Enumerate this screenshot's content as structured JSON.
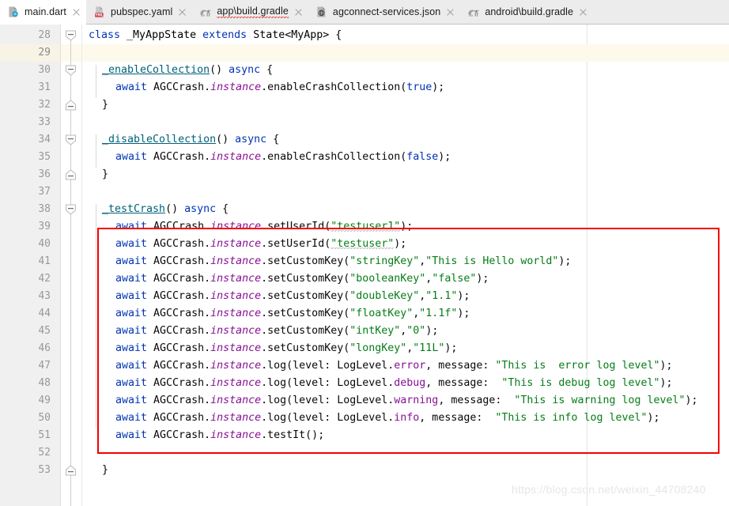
{
  "window": {
    "app": "IntelliJ IDEA / Android Studio editor",
    "background_color": "#ffffff",
    "accent_red": "#f50000"
  },
  "tabs": [
    {
      "label": "main.dart",
      "icon": "dart-file-icon",
      "active": true,
      "close": "×",
      "error": false
    },
    {
      "label": "pubspec.yaml",
      "icon": "yaml-file-icon",
      "active": false,
      "close": "×",
      "error": false
    },
    {
      "label": "app\\build.gradle",
      "icon": "gradle-file-icon",
      "active": false,
      "close": "×",
      "error": true
    },
    {
      "label": "agconnect-services.json",
      "icon": "json-file-icon",
      "active": false,
      "close": "×",
      "error": false
    },
    {
      "label": "android\\build.gradle",
      "icon": "gradle-file-icon",
      "active": false,
      "close": "×",
      "error": false
    }
  ],
  "editor": {
    "language": "Dart",
    "first_line": 28,
    "caret_line": 29,
    "line_height": 22,
    "lines": [
      {
        "number": 28,
        "indent": 0,
        "fold": "down",
        "tokens": [
          {
            "t": "class",
            "c": "k"
          },
          {
            "t": " ",
            "c": "pun"
          },
          {
            "t": "_MyAppState",
            "c": "cls"
          },
          {
            "t": " ",
            "c": "pun"
          },
          {
            "t": "extends",
            "c": "k"
          },
          {
            "t": " ",
            "c": "pun"
          },
          {
            "t": "State<MyApp> {",
            "c": "typ"
          }
        ]
      },
      {
        "number": 29,
        "indent": 0,
        "fold": "",
        "tokens": []
      },
      {
        "number": 30,
        "indent": 1,
        "fold": "down",
        "tokens": [
          {
            "t": "_enableCollection",
            "c": "mdecl"
          },
          {
            "t": "() ",
            "c": "pun"
          },
          {
            "t": "async",
            "c": "k"
          },
          {
            "t": " {",
            "c": "pun"
          }
        ]
      },
      {
        "number": 31,
        "indent": 2,
        "fold": "",
        "tokens": [
          {
            "t": "await",
            "c": "k"
          },
          {
            "t": " AGCCrash.",
            "c": "id"
          },
          {
            "t": "instance",
            "c": "fld"
          },
          {
            "t": ".enableCrashCollection(",
            "c": "id"
          },
          {
            "t": "true",
            "c": "k"
          },
          {
            "t": ");",
            "c": "pun"
          }
        ]
      },
      {
        "number": 32,
        "indent": 1,
        "fold": "up",
        "tokens": [
          {
            "t": "}",
            "c": "pun"
          }
        ]
      },
      {
        "number": 33,
        "indent": 0,
        "fold": "",
        "tokens": []
      },
      {
        "number": 34,
        "indent": 1,
        "fold": "down",
        "tokens": [
          {
            "t": "_disableCollection",
            "c": "mdecl"
          },
          {
            "t": "() ",
            "c": "pun"
          },
          {
            "t": "async",
            "c": "k"
          },
          {
            "t": " {",
            "c": "pun"
          }
        ]
      },
      {
        "number": 35,
        "indent": 2,
        "fold": "",
        "tokens": [
          {
            "t": "await",
            "c": "k"
          },
          {
            "t": " AGCCrash.",
            "c": "id"
          },
          {
            "t": "instance",
            "c": "fld"
          },
          {
            "t": ".enableCrashCollection(",
            "c": "id"
          },
          {
            "t": "false",
            "c": "k"
          },
          {
            "t": ");",
            "c": "pun"
          }
        ]
      },
      {
        "number": 36,
        "indent": 1,
        "fold": "up",
        "tokens": [
          {
            "t": "}",
            "c": "pun"
          }
        ]
      },
      {
        "number": 37,
        "indent": 0,
        "fold": "",
        "tokens": []
      },
      {
        "number": 38,
        "indent": 1,
        "fold": "down",
        "tokens": [
          {
            "t": "_testCrash",
            "c": "mdecl"
          },
          {
            "t": "() ",
            "c": "pun"
          },
          {
            "t": "async",
            "c": "k"
          },
          {
            "t": " {",
            "c": "pun"
          }
        ]
      },
      {
        "number": 39,
        "indent": 2,
        "fold": "",
        "tokens": [
          {
            "t": "await",
            "c": "k"
          },
          {
            "t": " AGCCrash.",
            "c": "id"
          },
          {
            "t": "instance",
            "c": "fld"
          },
          {
            "t": ".setUserId(",
            "c": "id"
          },
          {
            "t": "\"testuser1\"",
            "c": "str typo"
          },
          {
            "t": ");",
            "c": "pun"
          }
        ]
      },
      {
        "number": 40,
        "indent": 2,
        "fold": "",
        "tokens": [
          {
            "t": "await",
            "c": "k"
          },
          {
            "t": " AGCCrash.",
            "c": "id"
          },
          {
            "t": "instance",
            "c": "fld"
          },
          {
            "t": ".setUserId(",
            "c": "id"
          },
          {
            "t": "\"testuser\"",
            "c": "str typo"
          },
          {
            "t": ");",
            "c": "pun"
          }
        ]
      },
      {
        "number": 41,
        "indent": 2,
        "fold": "",
        "tokens": [
          {
            "t": "await",
            "c": "k"
          },
          {
            "t": " AGCCrash.",
            "c": "id"
          },
          {
            "t": "instance",
            "c": "fld"
          },
          {
            "t": ".setCustomKey(",
            "c": "id"
          },
          {
            "t": "\"stringKey\"",
            "c": "str"
          },
          {
            "t": ",",
            "c": "pun"
          },
          {
            "t": "\"This is Hello world\"",
            "c": "str"
          },
          {
            "t": ");",
            "c": "pun"
          }
        ]
      },
      {
        "number": 42,
        "indent": 2,
        "fold": "",
        "tokens": [
          {
            "t": "await",
            "c": "k"
          },
          {
            "t": " AGCCrash.",
            "c": "id"
          },
          {
            "t": "instance",
            "c": "fld"
          },
          {
            "t": ".setCustomKey(",
            "c": "id"
          },
          {
            "t": "\"booleanKey\"",
            "c": "str"
          },
          {
            "t": ",",
            "c": "pun"
          },
          {
            "t": "\"false\"",
            "c": "str"
          },
          {
            "t": ");",
            "c": "pun"
          }
        ]
      },
      {
        "number": 43,
        "indent": 2,
        "fold": "",
        "tokens": [
          {
            "t": "await",
            "c": "k"
          },
          {
            "t": " AGCCrash.",
            "c": "id"
          },
          {
            "t": "instance",
            "c": "fld"
          },
          {
            "t": ".setCustomKey(",
            "c": "id"
          },
          {
            "t": "\"doubleKey\"",
            "c": "str"
          },
          {
            "t": ",",
            "c": "pun"
          },
          {
            "t": "\"1.1\"",
            "c": "str"
          },
          {
            "t": ");",
            "c": "pun"
          }
        ]
      },
      {
        "number": 44,
        "indent": 2,
        "fold": "",
        "tokens": [
          {
            "t": "await",
            "c": "k"
          },
          {
            "t": " AGCCrash.",
            "c": "id"
          },
          {
            "t": "instance",
            "c": "fld"
          },
          {
            "t": ".setCustomKey(",
            "c": "id"
          },
          {
            "t": "\"floatKey\"",
            "c": "str"
          },
          {
            "t": ",",
            "c": "pun"
          },
          {
            "t": "\"1.1f\"",
            "c": "str"
          },
          {
            "t": ");",
            "c": "pun"
          }
        ]
      },
      {
        "number": 45,
        "indent": 2,
        "fold": "",
        "tokens": [
          {
            "t": "await",
            "c": "k"
          },
          {
            "t": " AGCCrash.",
            "c": "id"
          },
          {
            "t": "instance",
            "c": "fld"
          },
          {
            "t": ".setCustomKey(",
            "c": "id"
          },
          {
            "t": "\"intKey\"",
            "c": "str"
          },
          {
            "t": ",",
            "c": "pun"
          },
          {
            "t": "\"0\"",
            "c": "str"
          },
          {
            "t": ");",
            "c": "pun"
          }
        ]
      },
      {
        "number": 46,
        "indent": 2,
        "fold": "",
        "tokens": [
          {
            "t": "await",
            "c": "k"
          },
          {
            "t": " AGCCrash.",
            "c": "id"
          },
          {
            "t": "instance",
            "c": "fld"
          },
          {
            "t": ".setCustomKey(",
            "c": "id"
          },
          {
            "t": "\"longKey\"",
            "c": "str"
          },
          {
            "t": ",",
            "c": "pun"
          },
          {
            "t": "\"11L\"",
            "c": "str"
          },
          {
            "t": ");",
            "c": "pun"
          }
        ]
      },
      {
        "number": 47,
        "indent": 2,
        "fold": "",
        "tokens": [
          {
            "t": "await",
            "c": "k"
          },
          {
            "t": " AGCCrash.",
            "c": "id"
          },
          {
            "t": "instance",
            "c": "fld"
          },
          {
            "t": ".log(level: LogLevel.",
            "c": "id"
          },
          {
            "t": "error",
            "c": "en"
          },
          {
            "t": ", message: ",
            "c": "id"
          },
          {
            "t": "\"This is  error log level\"",
            "c": "str"
          },
          {
            "t": ");",
            "c": "pun"
          }
        ]
      },
      {
        "number": 48,
        "indent": 2,
        "fold": "",
        "tokens": [
          {
            "t": "await",
            "c": "k"
          },
          {
            "t": " AGCCrash.",
            "c": "id"
          },
          {
            "t": "instance",
            "c": "fld"
          },
          {
            "t": ".log(level: LogLevel.",
            "c": "id"
          },
          {
            "t": "debug",
            "c": "en"
          },
          {
            "t": ", message:  ",
            "c": "id"
          },
          {
            "t": "\"This is debug log level\"",
            "c": "str"
          },
          {
            "t": ");",
            "c": "pun"
          }
        ]
      },
      {
        "number": 49,
        "indent": 2,
        "fold": "",
        "tokens": [
          {
            "t": "await",
            "c": "k"
          },
          {
            "t": " AGCCrash.",
            "c": "id"
          },
          {
            "t": "instance",
            "c": "fld"
          },
          {
            "t": ".log(level: LogLevel.",
            "c": "id"
          },
          {
            "t": "warning",
            "c": "en"
          },
          {
            "t": ", message:  ",
            "c": "id"
          },
          {
            "t": "\"This is warning log level\"",
            "c": "str"
          },
          {
            "t": ");",
            "c": "pun"
          }
        ]
      },
      {
        "number": 50,
        "indent": 2,
        "fold": "",
        "tokens": [
          {
            "t": "await",
            "c": "k"
          },
          {
            "t": " AGCCrash.",
            "c": "id"
          },
          {
            "t": "instance",
            "c": "fld"
          },
          {
            "t": ".log(level: LogLevel.",
            "c": "id"
          },
          {
            "t": "info",
            "c": "en"
          },
          {
            "t": ", message:  ",
            "c": "id"
          },
          {
            "t": "\"This is info log level\"",
            "c": "str"
          },
          {
            "t": ");",
            "c": "pun"
          }
        ]
      },
      {
        "number": 51,
        "indent": 2,
        "fold": "",
        "tokens": [
          {
            "t": "await",
            "c": "k"
          },
          {
            "t": " AGCCrash.",
            "c": "id"
          },
          {
            "t": "instance",
            "c": "fld"
          },
          {
            "t": ".testIt();",
            "c": "id"
          }
        ]
      },
      {
        "number": 52,
        "indent": 0,
        "fold": "",
        "tokens": []
      },
      {
        "number": 53,
        "indent": 1,
        "fold": "up",
        "tokens": [
          {
            "t": "}",
            "c": "pun"
          }
        ]
      }
    ]
  },
  "annotation": {
    "type": "red-rectangle-highlight",
    "color": "#f50000",
    "covers_lines": "39-51"
  },
  "watermark": {
    "text": "https://blog.csdn.net/weixin_44708240"
  }
}
